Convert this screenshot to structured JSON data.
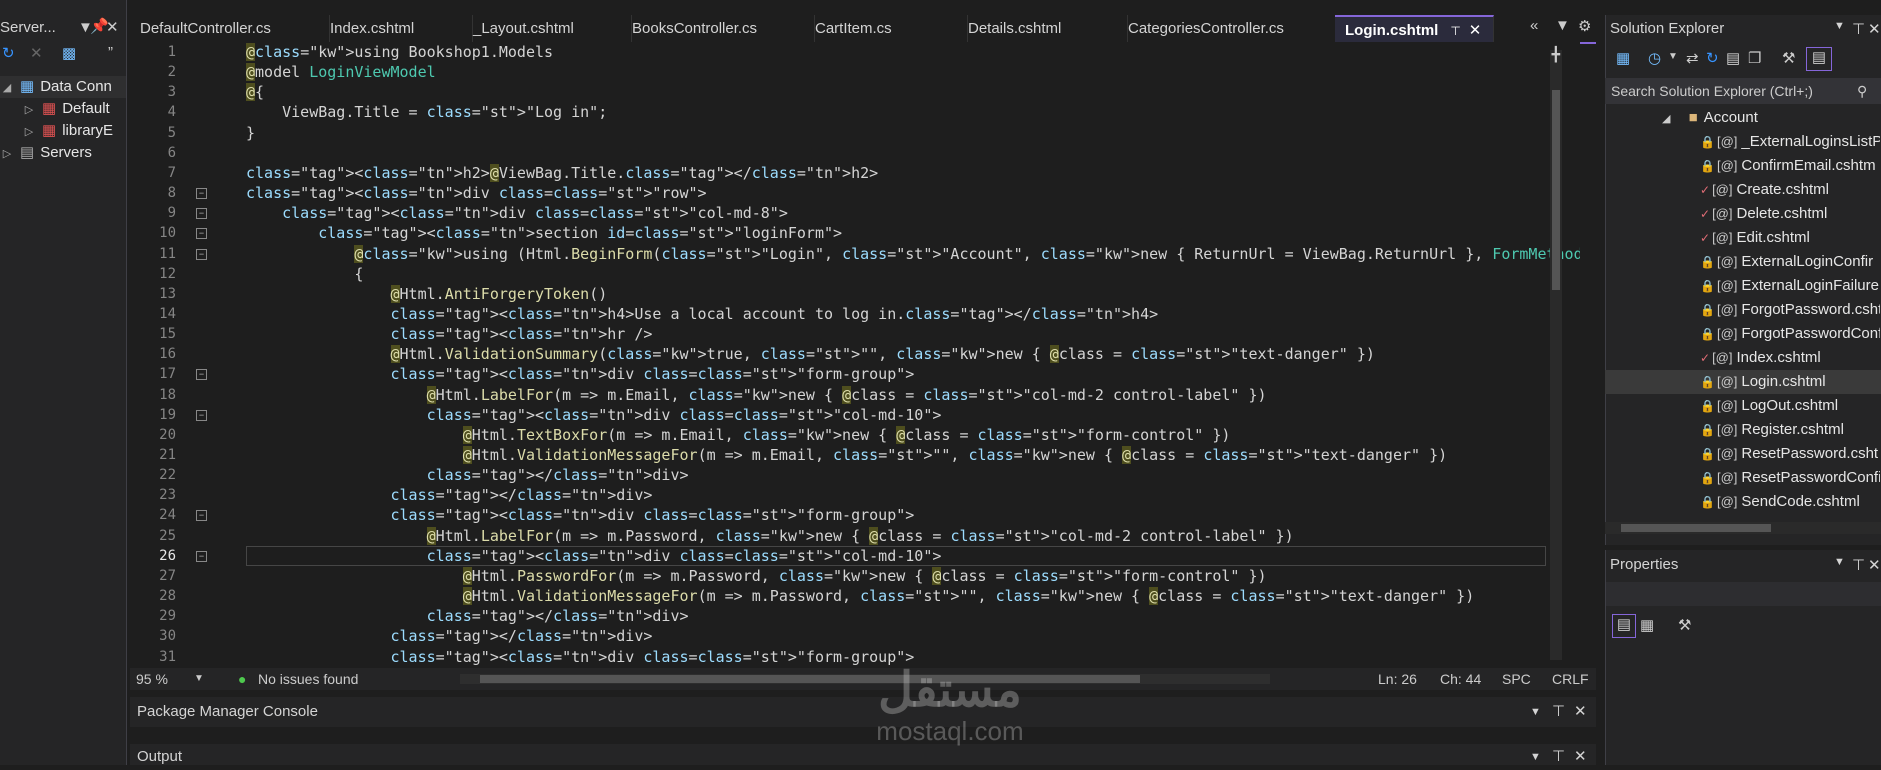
{
  "server_explorer": {
    "title": "Server...",
    "items": [
      {
        "label": "Data Conn"
      },
      {
        "label": "Default"
      },
      {
        "label": "libraryE"
      },
      {
        "label": "Servers"
      }
    ]
  },
  "tabs": [
    {
      "label": "DefaultController.cs"
    },
    {
      "label": "Index.cshtml"
    },
    {
      "label": "_Layout.cshtml"
    },
    {
      "label": "BooksController.cs"
    },
    {
      "label": "CartItem.cs"
    },
    {
      "label": "Details.cshtml"
    },
    {
      "label": "CategoriesController.cs"
    },
    {
      "label": "Login.cshtml"
    }
  ],
  "editor": {
    "lines": [
      "@using Bookshop1.Models",
      "@model LoginViewModel",
      "@{",
      "    ViewBag.Title = \"Log in\";",
      "}",
      "",
      "<h2>@ViewBag.Title.</h2>",
      "<div class=\"row\">",
      "    <div class=\"col-md-8\">",
      "        <section id=\"loginForm\">",
      "            @using (Html.BeginForm(\"Login\", \"Account\", new { ReturnUrl = ViewBag.ReturnUrl }, FormMethod.Post, new { @class = \"form-horizontal\", ro",
      "            {",
      "                @Html.AntiForgeryToken()",
      "                <h4>Use a local account to log in.</h4>",
      "                <hr />",
      "                @Html.ValidationSummary(true, \"\", new { @class = \"text-danger\" })",
      "                <div class=\"form-group\">",
      "                    @Html.LabelFor(m => m.Email, new { @class = \"col-md-2 control-label\" })",
      "                    <div class=\"col-md-10\">",
      "                        @Html.TextBoxFor(m => m.Email, new { @class = \"form-control\" })",
      "                        @Html.ValidationMessageFor(m => m.Email, \"\", new { @class = \"text-danger\" })",
      "                    </div>",
      "                </div>",
      "                <div class=\"form-group\">",
      "                    @Html.LabelFor(m => m.Password, new { @class = \"col-md-2 control-label\" })",
      "                    <div class=\"col-md-10\">",
      "                        @Html.PasswordFor(m => m.Password, new { @class = \"form-control\" })",
      "                        @Html.ValidationMessageFor(m => m.Password, \"\", new { @class = \"text-danger\" })",
      "                    </div>",
      "                </div>",
      "                <div class=\"form-group\">"
    ]
  },
  "status": {
    "zoom": "95 %",
    "issues": "No issues found",
    "line": "Ln: 26",
    "col": "Ch: 44",
    "spc": "SPC",
    "crlf": "CRLF"
  },
  "bottom": {
    "package_manager": "Package Manager Console",
    "output": "Output"
  },
  "solution_explorer": {
    "title": "Solution Explorer",
    "search_placeholder": "Search Solution Explorer (Ctrl+;)",
    "folder": "Account",
    "files": [
      {
        "label": "_ExternalLoginsListPa",
        "mark": "lock"
      },
      {
        "label": "ConfirmEmail.cshtm",
        "mark": "lock"
      },
      {
        "label": "Create.cshtml",
        "mark": "check"
      },
      {
        "label": "Delete.cshtml",
        "mark": "check"
      },
      {
        "label": "Edit.cshtml",
        "mark": "check"
      },
      {
        "label": "ExternalLoginConfir",
        "mark": "lock"
      },
      {
        "label": "ExternalLoginFailure",
        "mark": "lock"
      },
      {
        "label": "ForgotPassword.csht",
        "mark": "lock"
      },
      {
        "label": "ForgotPasswordConf",
        "mark": "lock"
      },
      {
        "label": "Index.cshtml",
        "mark": "check"
      },
      {
        "label": "Login.cshtml",
        "mark": "lock"
      },
      {
        "label": "LogOut.cshtml",
        "mark": "lock"
      },
      {
        "label": "Register.cshtml",
        "mark": "lock"
      },
      {
        "label": "ResetPassword.csht",
        "mark": "lock"
      },
      {
        "label": "ResetPasswordConfi",
        "mark": "lock"
      },
      {
        "label": "SendCode.cshtml",
        "mark": "lock"
      }
    ]
  },
  "properties": {
    "title": "Properties"
  },
  "watermark": {
    "text": "مستقل",
    "sub": "mostaql.com"
  },
  "colors": {
    "accent": "#8566d9",
    "editor_bg": "#1e1e1e",
    "panel_bg": "#252526"
  }
}
